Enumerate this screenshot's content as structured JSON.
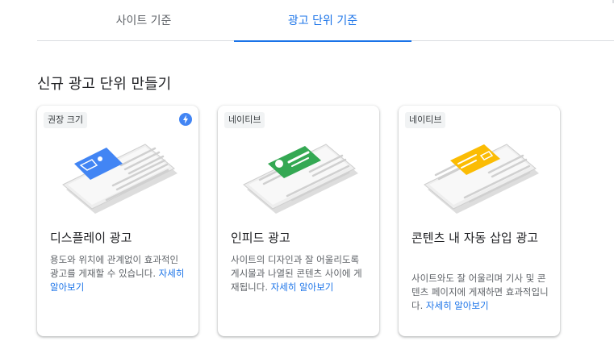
{
  "tabs": [
    {
      "label": "사이트 기준"
    },
    {
      "label": "광고 단위 기준"
    }
  ],
  "section_title": "신규 광고 단위 만들기",
  "cards": [
    {
      "chip": "권장 크기",
      "title": "디스플레이 광고",
      "desc": "용도와 위치에 관계없이 효과적인 광고를 게재할 수 있습니다. ",
      "link": "자세히 알아보기",
      "accent": "#4285f4",
      "icon": "lightning-icon"
    },
    {
      "chip": "네이티브",
      "title": "인피드 광고",
      "desc": "사이트의 디자인과 잘 어울리도록 게시물과 나열된 콘텐츠 사이에 게재됩니다. ",
      "link": "자세히 알아보기",
      "accent": "#34a853"
    },
    {
      "chip": "네이티브",
      "title": "콘텐츠 내 자동 삽입 광고",
      "desc": "사이트와도 잘 어울리며 기사 및 콘텐츠 페이지에 게재하면 효과적입니다. ",
      "link": "자세히 알아보기",
      "accent": "#fbbc04"
    }
  ]
}
